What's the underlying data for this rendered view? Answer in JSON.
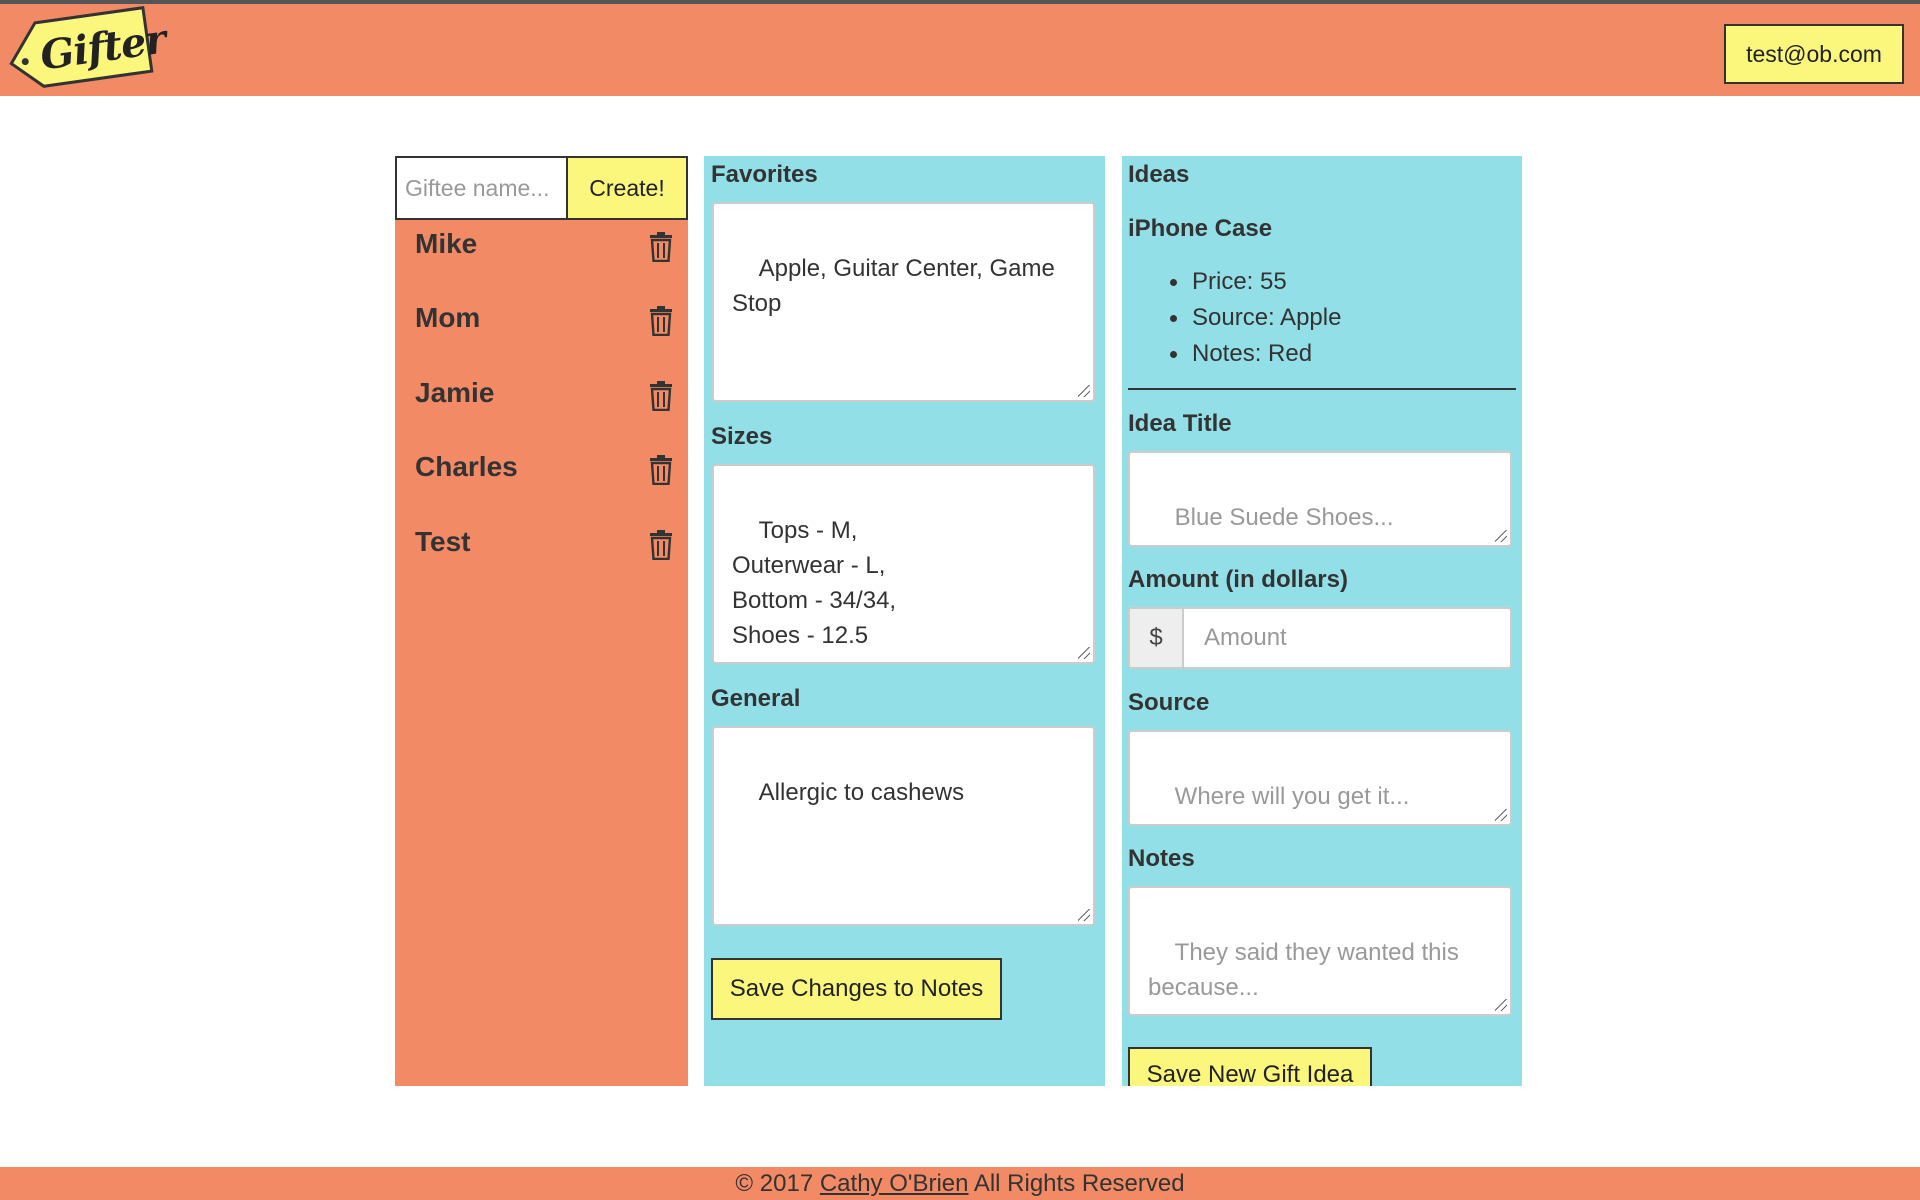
{
  "header": {
    "logo_text": "Gifter",
    "user_email": "test@ob.com"
  },
  "giftees": {
    "input_placeholder": "Giftee name...",
    "create_label": "Create!",
    "items": [
      {
        "name": "Mike"
      },
      {
        "name": "Mom"
      },
      {
        "name": "Jamie"
      },
      {
        "name": "Charles"
      },
      {
        "name": "Test"
      }
    ]
  },
  "notes": {
    "favorites_label": "Favorites",
    "favorites_value": "Apple, Guitar Center, Game\nStop",
    "sizes_label": "Sizes",
    "sizes_value": "Tops - M,\nOuterwear - L,\nBottom - 34/34,\nShoes - 12.5",
    "general_label": "General",
    "general_value": "Allergic to cashews",
    "save_label": "Save Changes to Notes"
  },
  "ideas": {
    "heading": "Ideas",
    "existing": {
      "title": "iPhone Case",
      "price": "Price: 55",
      "source": "Source: Apple",
      "notes": "Notes: Red"
    },
    "form": {
      "title_label": "Idea Title",
      "title_placeholder": "Blue Suede Shoes...",
      "amount_label": "Amount (in dollars)",
      "amount_addon": "$",
      "amount_placeholder": "Amount",
      "source_label": "Source",
      "source_placeholder": "Where will you get it...",
      "notes_label": "Notes",
      "notes_placeholder": "They said they wanted this\nbecause...",
      "save_label": "Save New Gift Idea"
    }
  },
  "footer": {
    "prefix": "© 2017 ",
    "author": "Cathy O'Brien",
    "suffix": " All Rights Reserved"
  },
  "colors": {
    "header_bg": "#F28A66",
    "panel_blue": "#92DFE7",
    "button_yellow": "#FBF67C"
  }
}
